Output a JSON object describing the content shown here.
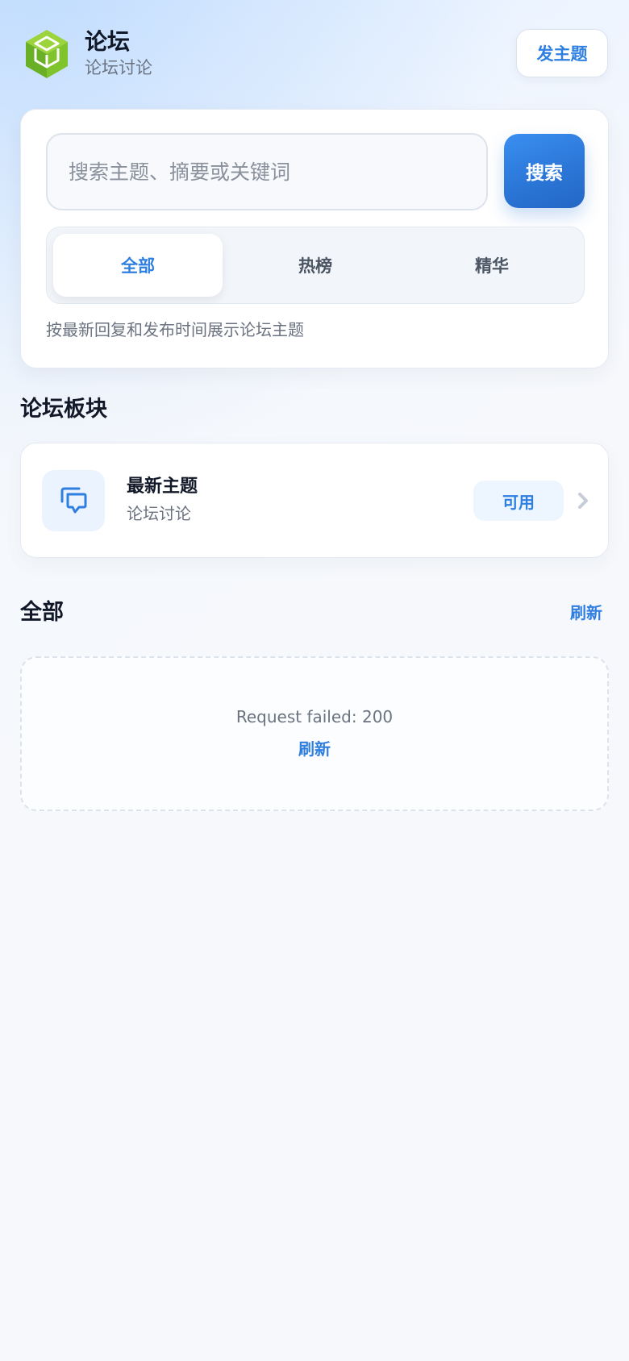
{
  "header": {
    "title": "论坛",
    "subtitle": "论坛讨论",
    "new_topic_label": "发主题"
  },
  "search": {
    "placeholder": "搜索主题、摘要或关键词",
    "button_label": "搜索",
    "tabs": [
      {
        "label": "全部",
        "active": true
      },
      {
        "label": "热榜",
        "active": false
      },
      {
        "label": "精华",
        "active": false
      }
    ],
    "hint": "按最新回复和发布时间展示论坛主题"
  },
  "boards": {
    "section_title": "论坛板块",
    "items": [
      {
        "title": "最新主题",
        "subtitle": "论坛讨论",
        "status": "可用",
        "icon": "chat-bubbles-icon"
      }
    ]
  },
  "topics": {
    "section_title": "全部",
    "refresh_label": "刷新",
    "error_message": "Request failed: 200",
    "empty_refresh_label": "刷新"
  },
  "colors": {
    "accent": "#2f7fe0",
    "logo_green": "#7bc42d",
    "badge_bg": "#edf5fe"
  }
}
